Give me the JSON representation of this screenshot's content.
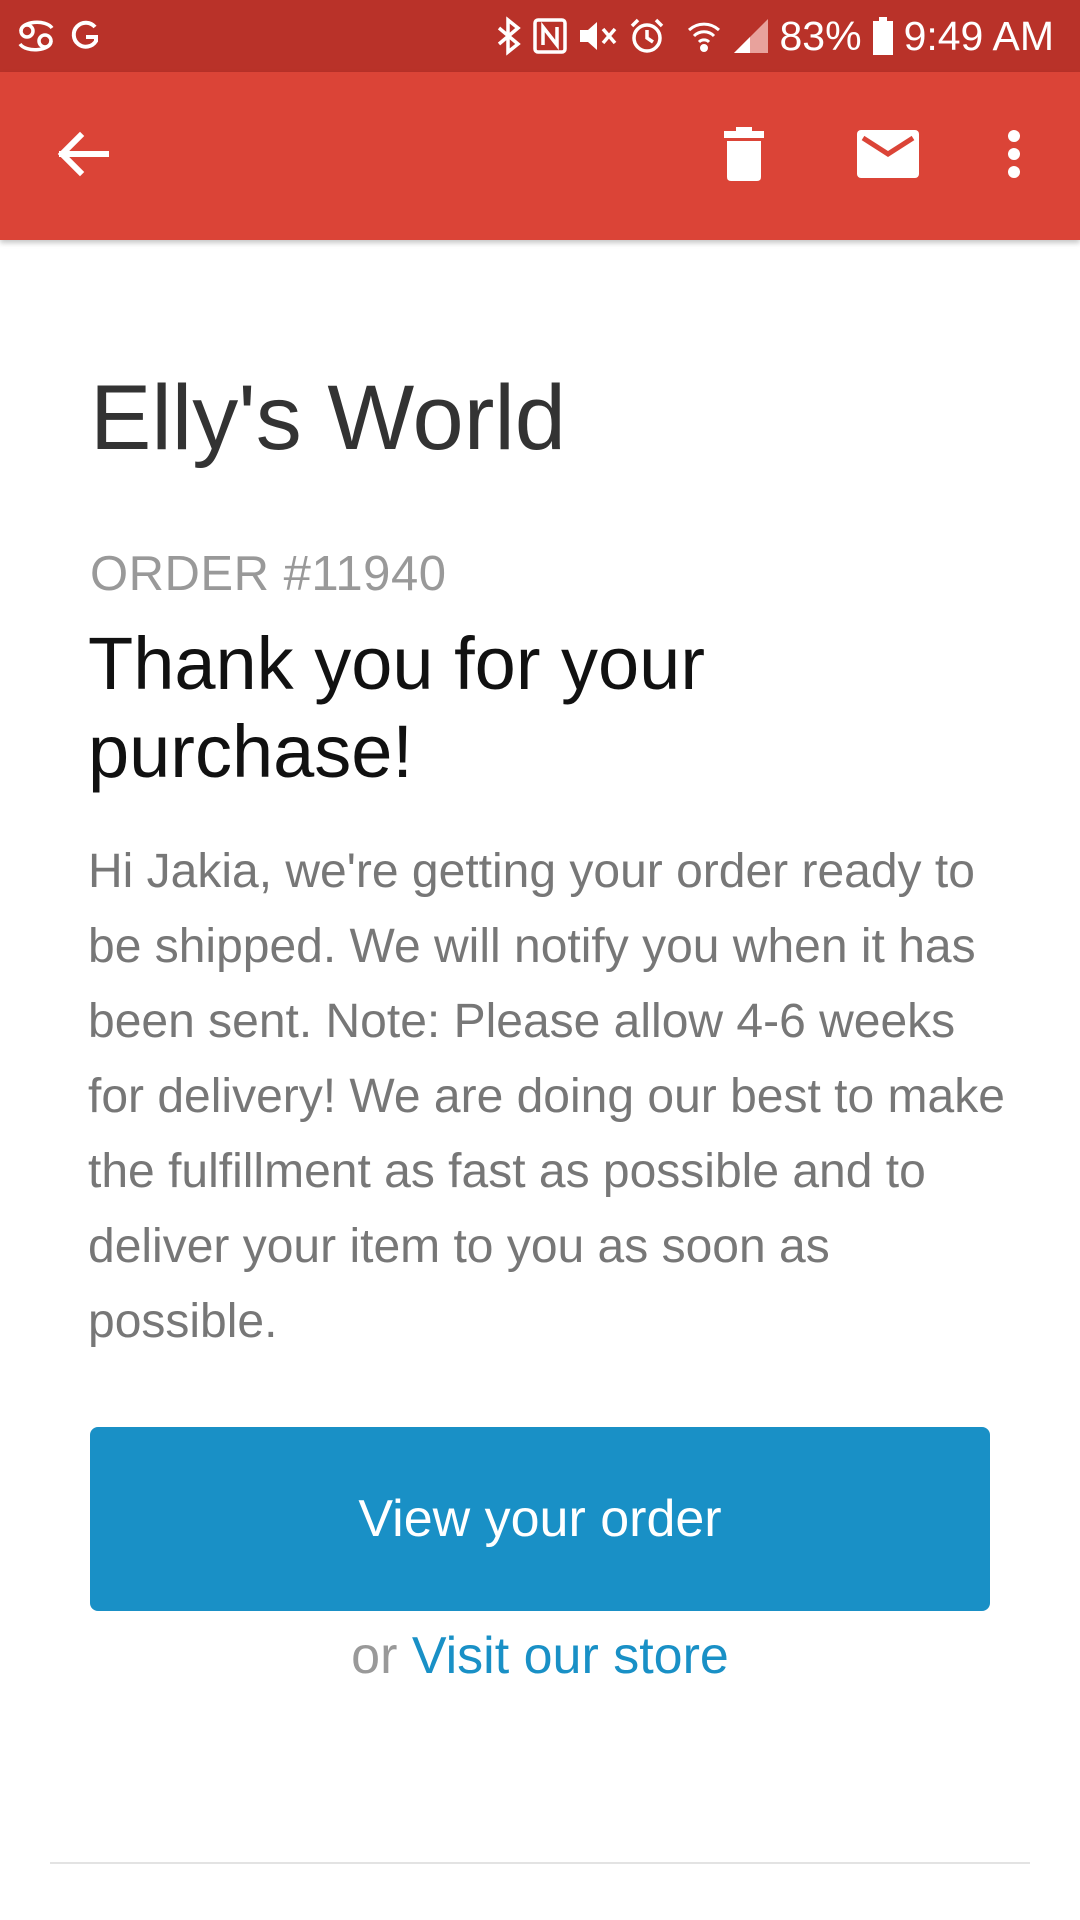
{
  "status_bar": {
    "battery": "83%",
    "time": "9:49 AM",
    "icons": [
      "cancer-zodiac-icon",
      "g-letter-icon",
      "bluetooth-icon",
      "nfc-icon",
      "muted-icon",
      "alarm-icon",
      "wifi-icon",
      "signal-icon",
      "battery-icon"
    ]
  },
  "app_bar": {
    "color": "#db4437",
    "icons": [
      "back-arrow-icon",
      "trash-icon",
      "mail-icon",
      "more-vert-icon"
    ]
  },
  "email": {
    "shop_name": "Elly's World",
    "order_number": "ORDER #11940",
    "heading": "Thank you for your purchase!",
    "message": "Hi Jakia, we're getting your order ready to be shipped. We will notify you when it has been sent. Note: Please allow 4-6 weeks for delivery! We are doing our best to make the fulfillment as fast as possible and to deliver your item to you as soon as possible.",
    "view_order_label": "View your order",
    "or_text": "or",
    "visit_store_label": "Visit our store",
    "accent_color": "#1990c6"
  }
}
